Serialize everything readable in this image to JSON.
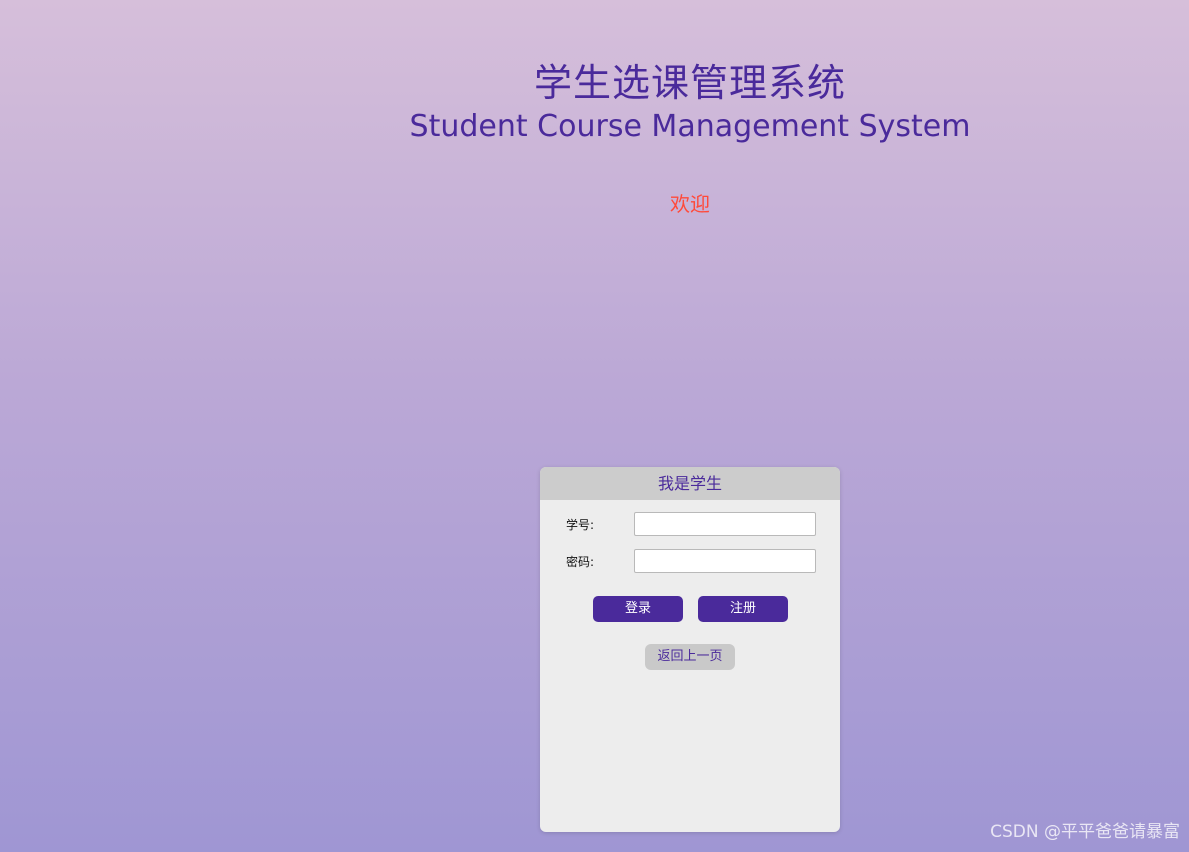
{
  "header": {
    "title_cn": "学生选课管理系统",
    "title_en": "Student Course Management System",
    "welcome": "欢迎"
  },
  "login_card": {
    "heading": "我是学生",
    "fields": [
      {
        "label": "学号:",
        "value": "",
        "placeholder": ""
      },
      {
        "label": "密码:",
        "value": "",
        "placeholder": ""
      }
    ],
    "login_label": "登录",
    "register_label": "注册",
    "back_label": "返回上一页"
  },
  "watermark": "CSDN @平平爸爸请暴富",
  "colors": {
    "accent": "#4a2a9b",
    "welcome": "#ff4a3a",
    "card_bg": "#ededed",
    "card_header_bg": "#cccccc"
  }
}
